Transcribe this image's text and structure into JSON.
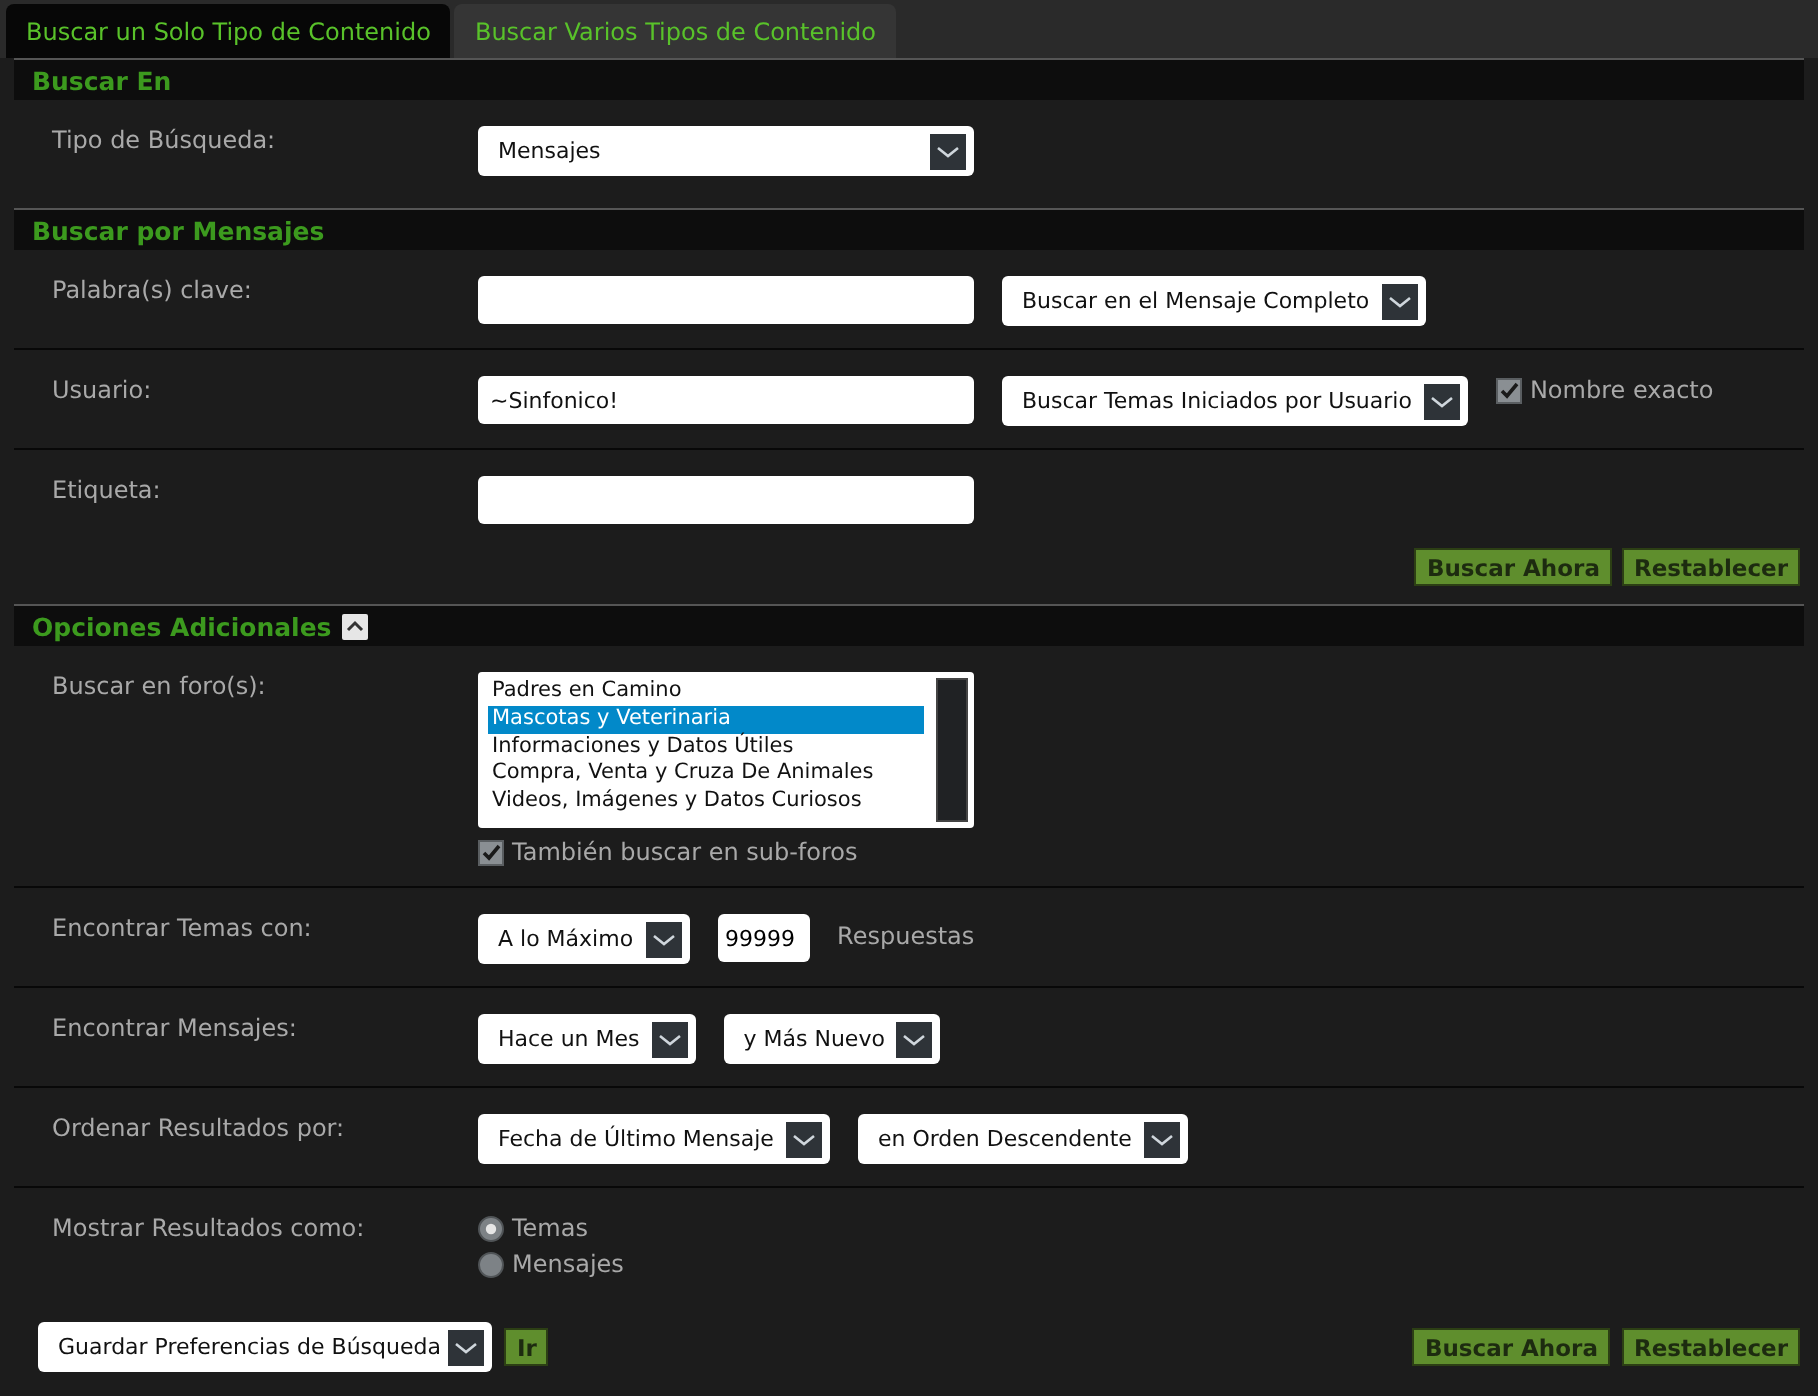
{
  "tabs": [
    {
      "label": "Buscar un Solo Tipo de Contenido",
      "selected": true
    },
    {
      "label": "Buscar Varios Tipos de Contenido",
      "selected": false
    }
  ],
  "sections": [
    {
      "title": "Buscar En",
      "rows": [
        {
          "label": "Tipo de Búsqueda:",
          "controls": [
            {
              "kind": "select",
              "value": "Mensajes"
            }
          ]
        }
      ]
    },
    {
      "title": "Buscar por Mensajes",
      "rows": [
        {
          "label": "Palabra(s) clave:",
          "controls": [
            {
              "kind": "text"
            },
            {
              "kind": "select",
              "value": "Buscar en el Mensaje Completo"
            }
          ]
        },
        {
          "label": "Usuario:",
          "controls": [
            {
              "kind": "text",
              "value": "~Sinfonico!"
            },
            {
              "kind": "select",
              "value": "Buscar Temas Iniciados por Usuario"
            },
            {
              "kind": "checkbox",
              "label": "Nombre exacto",
              "checked": true
            }
          ]
        },
        {
          "label": "Etiqueta:",
          "controls": [
            {
              "kind": "text"
            }
          ]
        }
      ],
      "buttons": [
        "Buscar Ahora",
        "Restablecer"
      ]
    },
    {
      "title": "Opciones Adicionales",
      "expanded": true,
      "rows": [
        {
          "label": "Buscar en foro(s):",
          "controls": [
            {
              "kind": "listbox",
              "items": [
                {
                  "label": "Padres en Camino",
                  "selected": false
                },
                {
                  "label": "Mascotas y Veterinaria",
                  "selected": true
                },
                {
                  "label": "Informaciones y Datos Útiles",
                  "selected": false
                },
                {
                  "label": "Compra, Venta y Cruza De Animales",
                  "selected": false
                },
                {
                  "label": "Videos, Imágenes y Datos Curiosos",
                  "selected": false
                }
              ]
            },
            {
              "kind": "checkbox",
              "label": "También buscar en sub-foros",
              "checked": true
            }
          ]
        },
        {
          "label": "Encontrar Temas con:",
          "controls": [
            {
              "kind": "select",
              "value": "A lo Máximo"
            },
            {
              "kind": "number",
              "value": "99999"
            },
            {
              "kind": "note",
              "label": "Respuestas"
            }
          ]
        },
        {
          "label": "Encontrar Mensajes:",
          "controls": [
            {
              "kind": "select",
              "value": "Hace un Mes"
            },
            {
              "kind": "select",
              "value": "y Más Nuevo"
            }
          ]
        },
        {
          "label": "Ordenar Resultados por:",
          "controls": [
            {
              "kind": "select",
              "value": "Fecha de Último Mensaje"
            },
            {
              "kind": "select",
              "value": "en Orden Descendente"
            }
          ]
        },
        {
          "label": "Mostrar Resultados como:",
          "controls": [
            {
              "kind": "radio",
              "label": "Temas",
              "selected": true
            },
            {
              "kind": "radio",
              "label": "Mensajes",
              "selected": false
            }
          ]
        }
      ]
    }
  ],
  "footer": {
    "select": "Guardar Preferencias de Búsqueda",
    "go": "Ir",
    "buttons": [
      "Buscar Ahora",
      "Restablecer"
    ]
  }
}
